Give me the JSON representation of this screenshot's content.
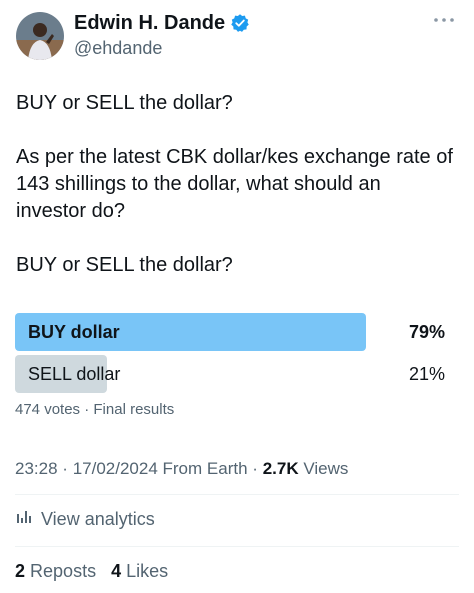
{
  "author": {
    "display_name": "Edwin H. Dande",
    "handle": "@ehdande",
    "verified": true,
    "verified_icon": "verified-badge-icon",
    "verified_color": "#1d9bf0"
  },
  "more_icon": "more-horizontal-icon",
  "tweet": {
    "paragraph_1": "BUY or SELL the dollar?",
    "paragraph_2": "As per the latest CBK dollar/kes exchange rate of 143 shillings to the dollar, what should an investor do?",
    "paragraph_3": "BUY or SELL the dollar?"
  },
  "poll": {
    "options": [
      {
        "label": "BUY dollar",
        "percent_label": "79%",
        "share": 0.79,
        "color": "#79c5f7",
        "winner": true
      },
      {
        "label": "SELL dollar",
        "percent_label": "21%",
        "share": 0.21,
        "color": "#cfd9de",
        "winner": false
      }
    ],
    "votes": "474 votes",
    "separator": "·",
    "status": "Final results"
  },
  "meta": {
    "time": "23:28",
    "date": "17/02/2024",
    "source": "From Earth",
    "views_count": "2.7K",
    "views_label": "Views",
    "separator": "·"
  },
  "analytics": {
    "label": "View analytics",
    "icon": "analytics-bars-icon"
  },
  "engagement": {
    "reposts_count": "2",
    "reposts_label": "Reposts",
    "likes_count": "4",
    "likes_label": "Likes"
  }
}
